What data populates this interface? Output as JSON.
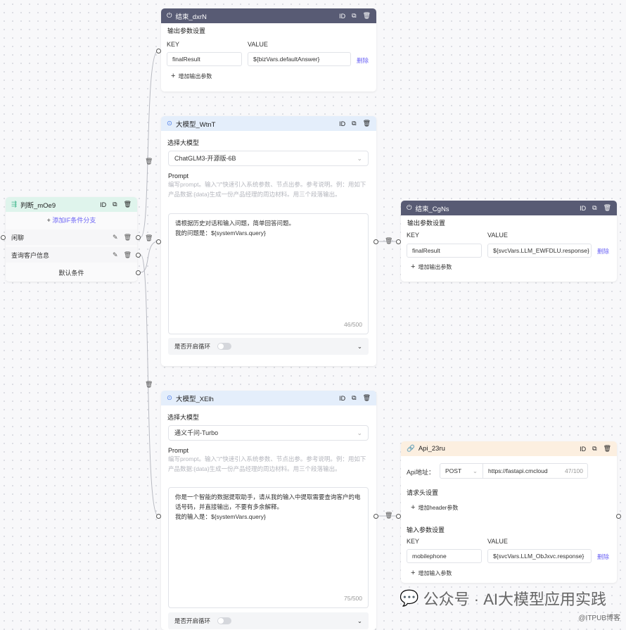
{
  "end_top": {
    "title": "结束_dxrN",
    "id": "ID",
    "section": "输出参数设置",
    "key_label": "KEY",
    "value_label": "VALUE",
    "key": "finalResult",
    "value": "${bizVars.defaultAnswer}",
    "delete": "删除",
    "add": "增加输出参数"
  },
  "llm1": {
    "title": "大模型_WtnT",
    "id": "ID",
    "select_label": "选择大模型",
    "model": "ChatGLM3-开源版-6B",
    "prompt_label": "Prompt",
    "hint": "编写prompt。输入\"/\"快速引入系统参数、节点出参。参考说明。例：用如下产品数据:{data}生成一份产品经理的周边材料。用三个段落输出。",
    "prompt_line1": "请根据历史对话和输入问题，简单回答问题。",
    "prompt_line2": "我的问题是：${systemVars.query}",
    "count": "46/500",
    "loop": "是否开启循环"
  },
  "judge": {
    "title": "判断_mOe9",
    "id": "ID",
    "add": "添加IF条件分支",
    "branches": [
      "闲聊",
      "查询客户信息"
    ],
    "default": "默认条件"
  },
  "end_right": {
    "title": "结束_CgNs",
    "id": "ID",
    "section": "输出参数设置",
    "key_label": "KEY",
    "value_label": "VALUE",
    "key": "finalResult",
    "value": "${svcVars.LLM_EWFDLU.response}",
    "delete": "删除",
    "add": "增加输出参数"
  },
  "llm2": {
    "title": "大模型_XElh",
    "id": "ID",
    "select_label": "选择大模型",
    "model": "通义千问-Turbo",
    "prompt_label": "Prompt",
    "hint": "编写prompt。输入\"/\"快速引入系统参数、节点出参。参考说明。例：用如下产品数据:{data}生成一份产品经理的周边材料。用三个段落输出。",
    "prompt_line1": "你是一个智能的数据提取助手，请从我的输入中提取需要查询客户的电话号码，并直接输出，不要有多余解释。",
    "prompt_line2": "我的输入是：${systemVars.query}",
    "count": "75/500",
    "loop": "是否开启循环"
  },
  "api": {
    "title": "Api_23ru",
    "id": "ID",
    "addr_label": "Api地址：",
    "method": "POST",
    "url": "https://fastapi.cmcloud",
    "url_count": "47/100",
    "header_section": "请求头设置",
    "add_header": "增加header参数",
    "input_section": "输入参数设置",
    "key_label": "KEY",
    "value_label": "VALUE",
    "key": "mobilephone",
    "value": "${svcVars.LLM_ObJxvc.response}",
    "delete": "删除",
    "add_input": "增加输入参数"
  },
  "watermark": {
    "text": "公众号 · AI大模型应用实践",
    "source": "@ITPUB博客"
  }
}
